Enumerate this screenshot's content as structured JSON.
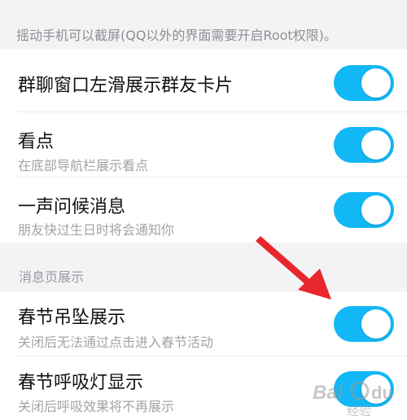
{
  "header_note": "摇动手机可以截屏(QQ以外的界面需要开启Root权限)。",
  "settings": [
    {
      "title": "群聊窗口左滑展示群友卡片",
      "subtitle": "",
      "enabled": true
    },
    {
      "title": "看点",
      "subtitle": "在底部导航栏展示看点",
      "enabled": true
    },
    {
      "title": "一声问候消息",
      "subtitle": "朋友快过生日时将会通知你",
      "enabled": true
    }
  ],
  "section_header": "消息页展示",
  "message_settings": [
    {
      "title": "春节吊坠展示",
      "subtitle": "关闭后无法通过点击进入春节活动",
      "enabled": true
    },
    {
      "title": "春节呼吸灯显示",
      "subtitle": "关闭后呼吸效果将不再展示",
      "enabled": true
    }
  ],
  "colors": {
    "toggle_on": "#12b7f5",
    "arrow": "#e8272d",
    "section_bg": "#f3f3f5"
  },
  "watermark": "Baidu 经验"
}
